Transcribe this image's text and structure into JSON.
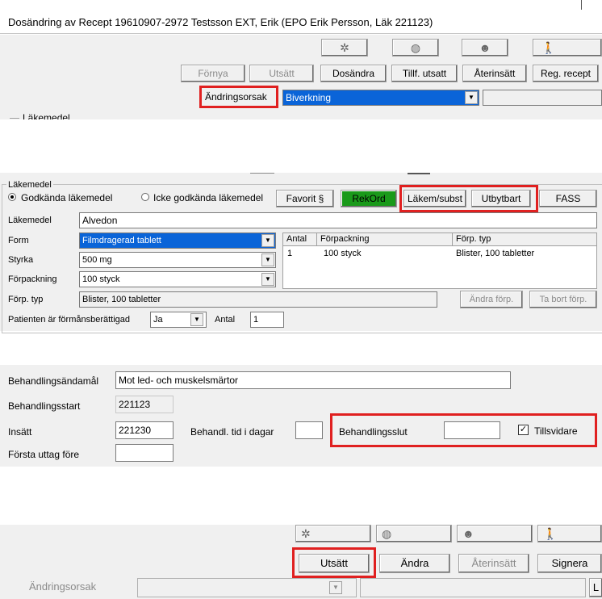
{
  "dialog1": {
    "title": "Dosändring av Recept  19610907-2972 Testsson EXT, Erik (EPO Erik Persson, Läk 221123)",
    "icons": [
      "snowflake-icon",
      "globe-icon",
      "person-icon",
      "walking-person-icon"
    ],
    "buttons": {
      "fornya": "Förnya",
      "utsatt": "Utsätt",
      "dosandra": "Dosändra",
      "tillf_utsatt": "Tillf. utsatt",
      "aterinsatt": "Återinsätt",
      "reg_recept": "Reg. recept"
    },
    "andringsorsak_label": "Ändringsorsak",
    "andringsorsak_value": "Biverkning",
    "lakemedel_cut": "Läkemedel"
  },
  "dialog2": {
    "group_label": "Läkemedel",
    "radio_godkanda": "Godkända läkemedel",
    "radio_icke": "Icke godkända läkemedel",
    "btn_favorit": "Favorit §",
    "btn_rekord": "RekOrd",
    "btn_lakem_subst": "Läkem/subst",
    "btn_utbytbart": "Utbytbart",
    "btn_fass": "FASS",
    "lakemedel_label": "Läkemedel",
    "lakemedel_value": "Alvedon",
    "form_label": "Form",
    "form_value": "Filmdragerad tablett",
    "styrka_label": "Styrka",
    "styrka_value": "500 mg",
    "forpackning_label": "Förpackning",
    "forpackning_value": "100 styck",
    "forp_typ_label": "Förp. typ",
    "forp_typ_value": "Blister, 100 tabletter",
    "formansberattigad_label": "Patienten är förmånsberättigad",
    "formansberattigad_value": "Ja",
    "antal_label": "Antal",
    "antal_value": "1",
    "table": {
      "headers": [
        "Antal",
        "Förpackning",
        "Förp. typ"
      ],
      "rows": [
        [
          "1",
          "100 styck",
          "Blister, 100 tabletter"
        ]
      ]
    },
    "btn_andra_forp": "Ändra förp.",
    "btn_ta_bort_forp": "Ta bort förp."
  },
  "dialog3": {
    "behandlingsandamal_label": "Behandlingsändamål",
    "behandlingsandamal_value": "Mot led- och muskelsmärtor",
    "behandlingsstart_label": "Behandlingsstart",
    "behandlingsstart_value": "221123",
    "insatt_label": "Insätt",
    "insatt_value": "221230",
    "behandl_tid_label": "Behandl. tid i dagar",
    "behandl_tid_value": "",
    "behandlingsslut_label": "Behandlingsslut",
    "behandlingsslut_value": "",
    "tillsvidare_label": "Tillsvidare",
    "forsta_uttag_label": "Första uttag före",
    "forsta_uttag_value": ""
  },
  "dialog4": {
    "btn_utsatt": "Utsätt",
    "btn_andra": "Ändra",
    "btn_aterinsatt": "Återinsätt",
    "btn_signera": "Signera",
    "andringsorsak_label": "Ändringsorsak",
    "cut_button": "L"
  },
  "colors": {
    "highlight": "#e02020",
    "selection": "#0a64d8",
    "rekord_green": "#1a9a1a"
  }
}
